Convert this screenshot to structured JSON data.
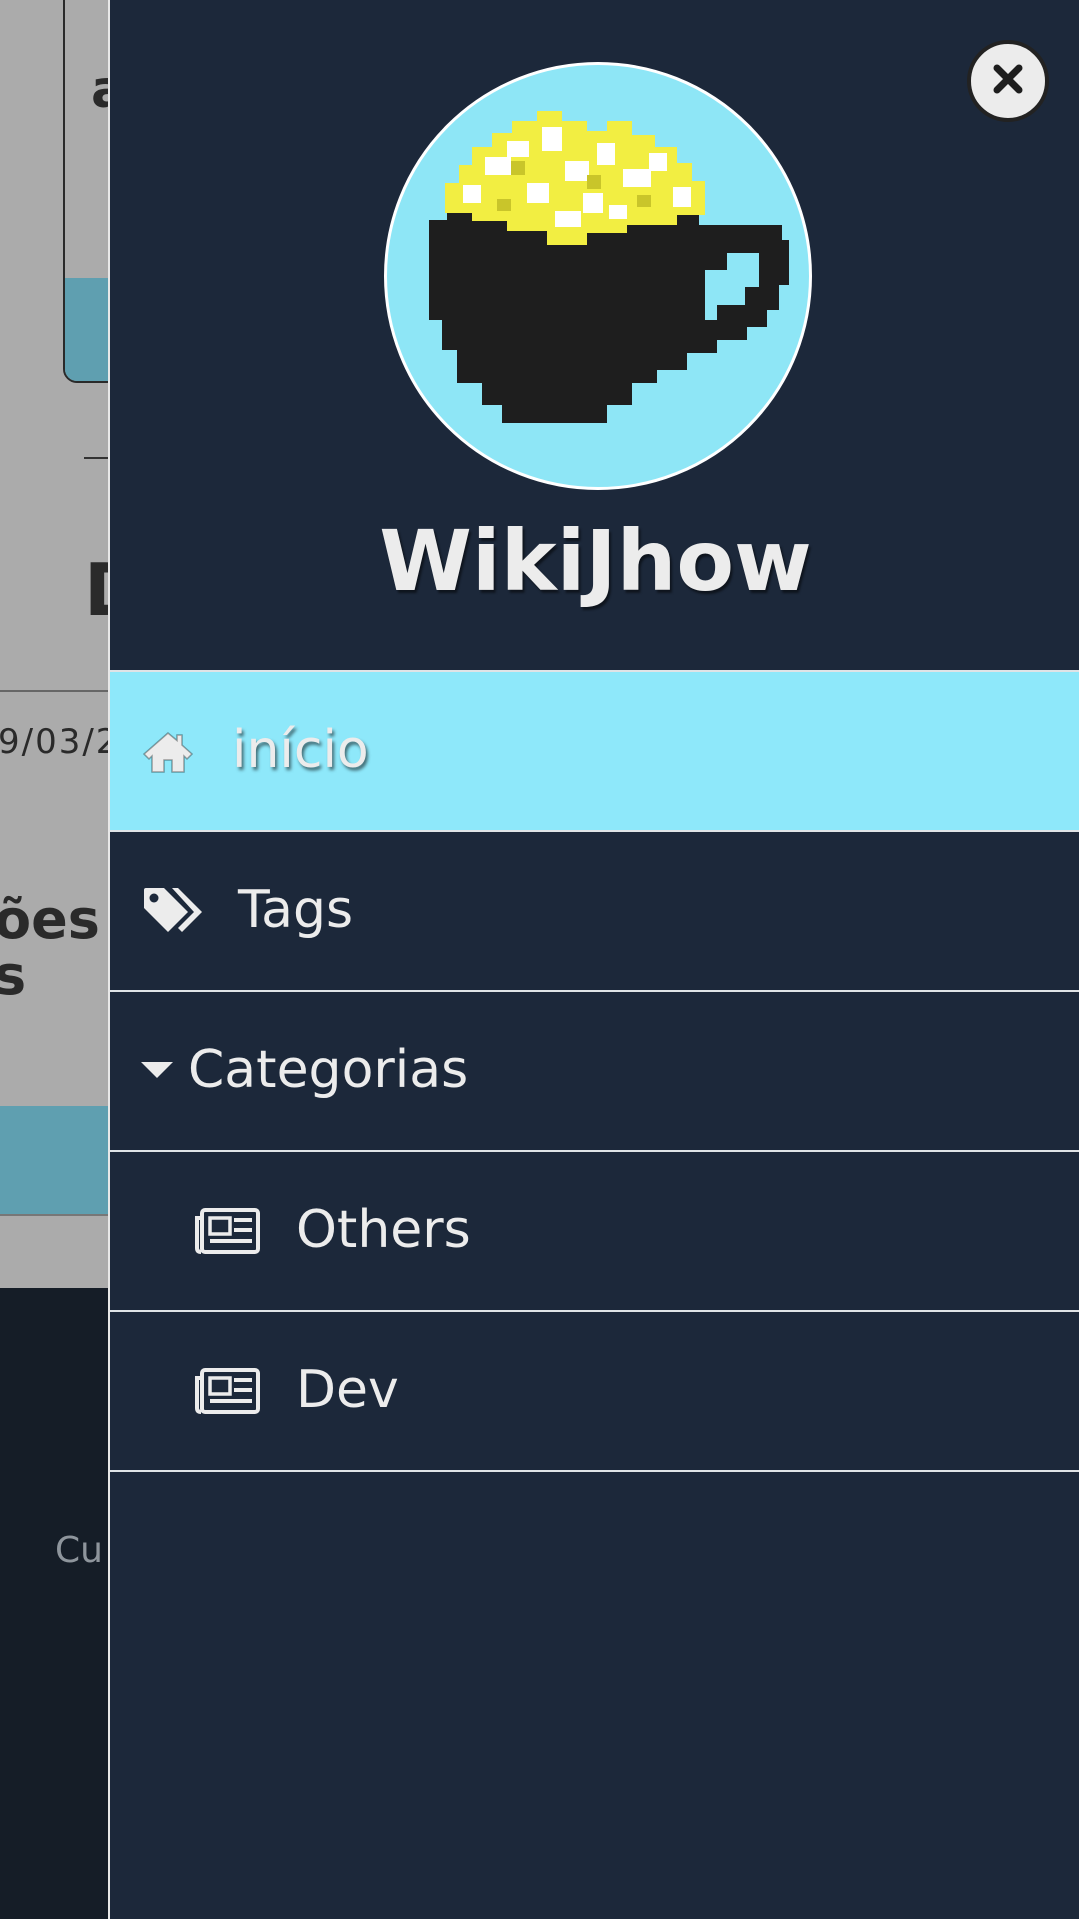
{
  "background_page": {
    "card_letter": "a",
    "heading_fragment": "D",
    "date_fragment": "9/03/2",
    "title_fragment_line1": "ões",
    "title_fragment_line2": "s",
    "footer_fragment": "Cu"
  },
  "drawer": {
    "close_icon": "close-icon",
    "avatar_icon": "coffee-cup-popcorn-avatar",
    "site_name": "WikiJhow",
    "colors": {
      "drawer_bg": "#1c283a",
      "active_bg": "#8ee8fa",
      "text": "#ececec",
      "divider": "#dfe3e6"
    },
    "menu": [
      {
        "label": "início",
        "icon": "home-icon",
        "active": true
      },
      {
        "label": "Tags",
        "icon": "tags-icon",
        "active": false
      },
      {
        "label": "Categorias",
        "icon": "caret-down-icon",
        "active": false
      },
      {
        "label": "Others",
        "icon": "newspaper-icon",
        "active": false
      },
      {
        "label": "Dev",
        "icon": "newspaper-icon",
        "active": false
      }
    ]
  }
}
